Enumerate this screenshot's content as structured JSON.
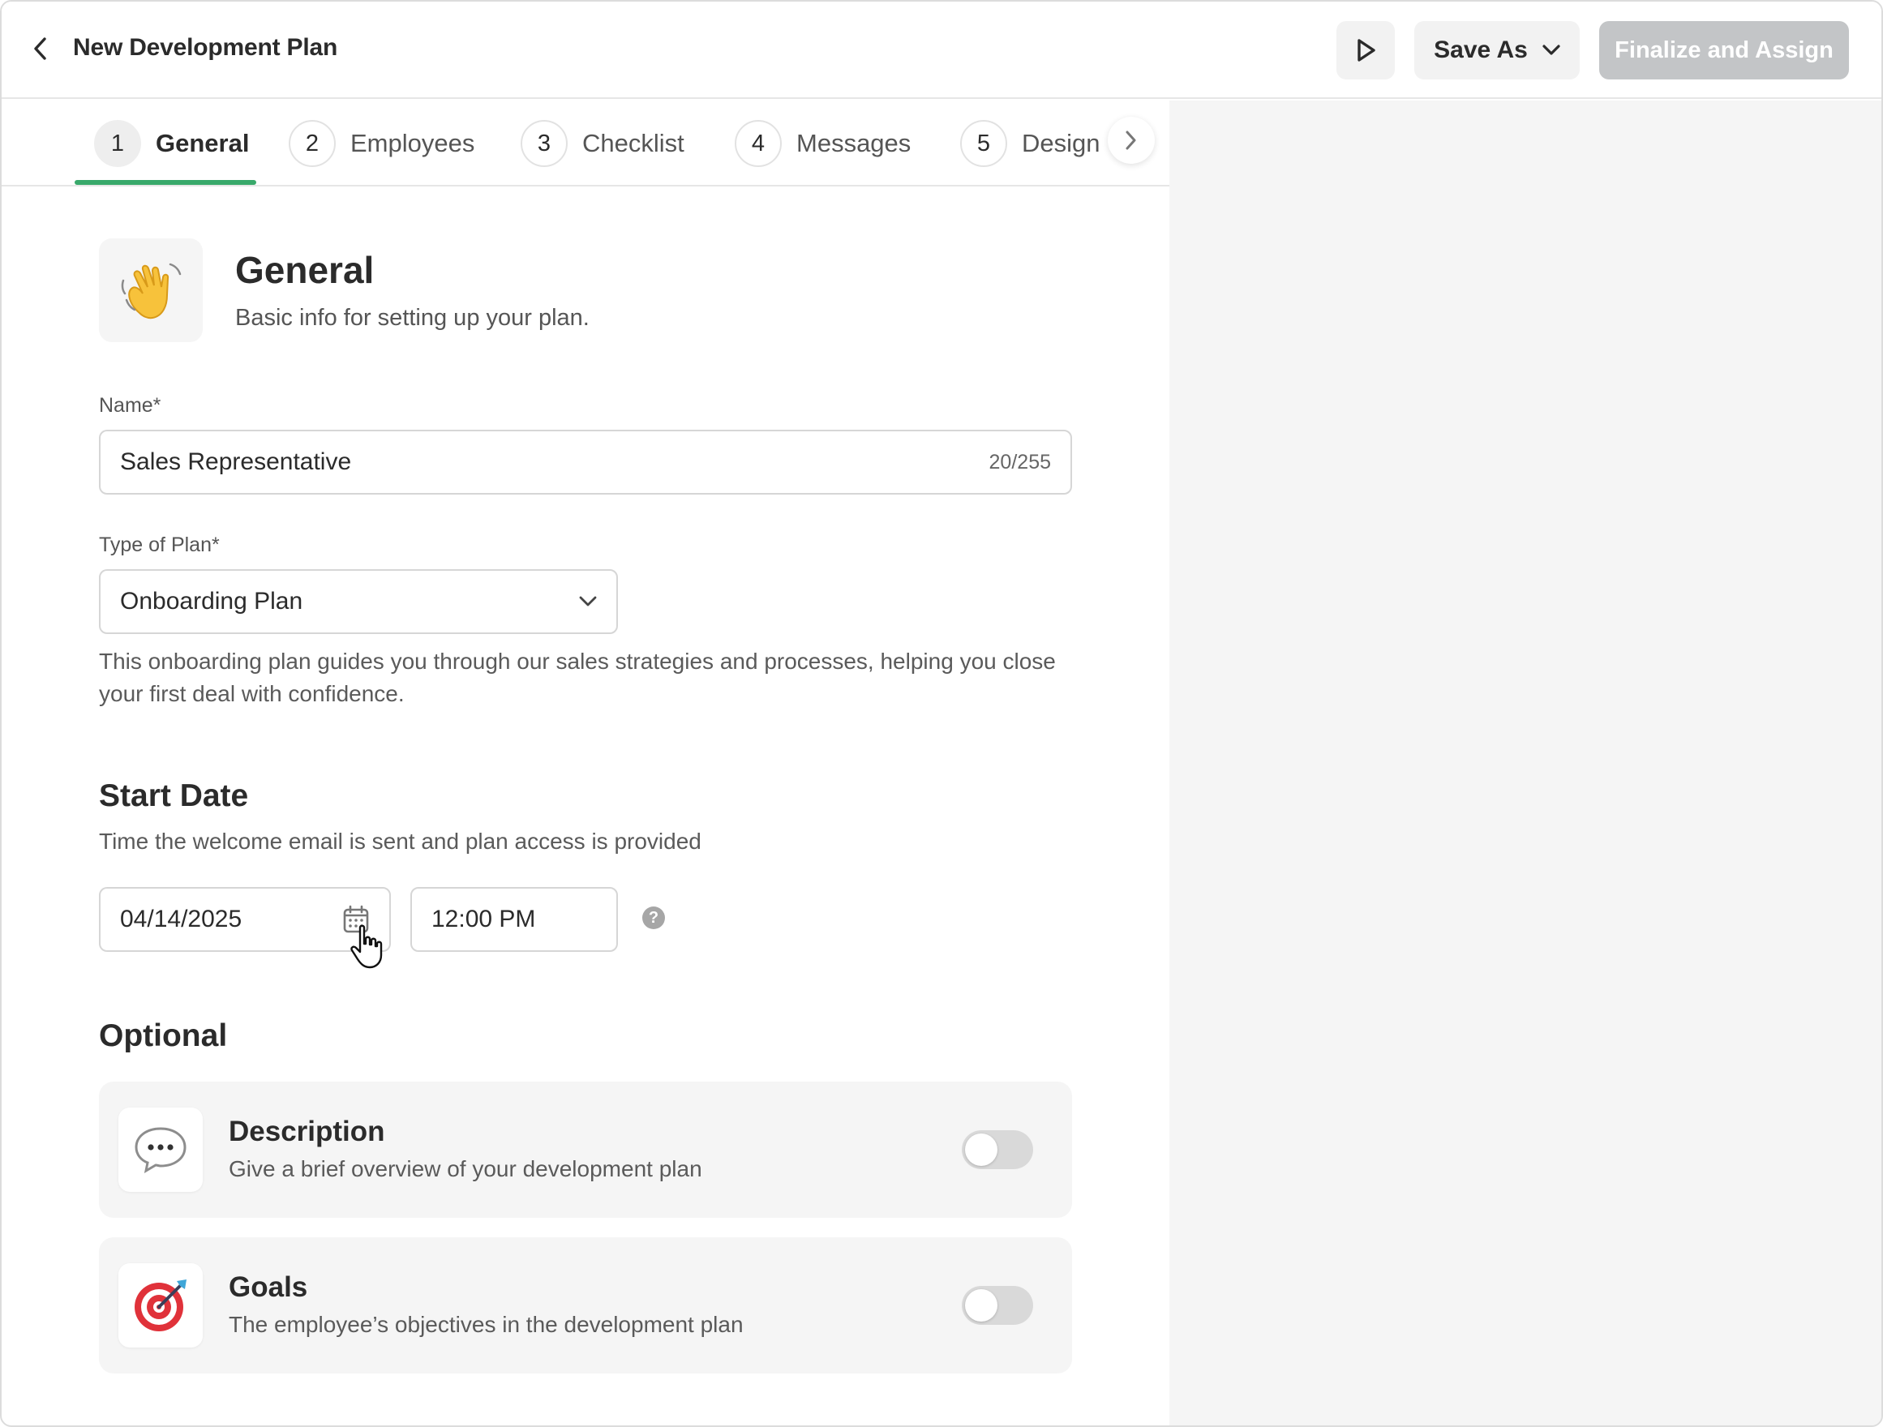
{
  "header": {
    "title": "New Development Plan",
    "save_as_label": "Save As",
    "finalize_label": "Finalize and Assign"
  },
  "steps": [
    {
      "num": "1",
      "label": "General"
    },
    {
      "num": "2",
      "label": "Employees"
    },
    {
      "num": "3",
      "label": "Checklist"
    },
    {
      "num": "4",
      "label": "Messages"
    },
    {
      "num": "5",
      "label": "Design"
    }
  ],
  "section": {
    "title": "General",
    "subtitle": "Basic info for setting up your plan."
  },
  "name_field": {
    "label": "Name*",
    "value": "Sales Representative",
    "counter": "20/255"
  },
  "plan_type": {
    "label": "Type of Plan*",
    "value": "Onboarding Plan",
    "helper": "This onboarding plan guides you through our sales strategies and processes, helping you close your first deal with confidence."
  },
  "start_date": {
    "title": "Start Date",
    "subtitle": "Time the welcome email is sent and plan access is provided",
    "date": "04/14/2025",
    "time": "12:00 PM",
    "help": "?"
  },
  "optional": {
    "title": "Optional",
    "items": [
      {
        "title": "Description",
        "subtitle": "Give a brief overview of your development plan",
        "enabled": false
      },
      {
        "title": "Goals",
        "subtitle": "The employee’s objectives in the development plan",
        "enabled": false
      }
    ]
  },
  "colors": {
    "accent": "#39a96b",
    "finalize_disabled": "#c3c5c7",
    "panel": "#f5f5f5"
  }
}
